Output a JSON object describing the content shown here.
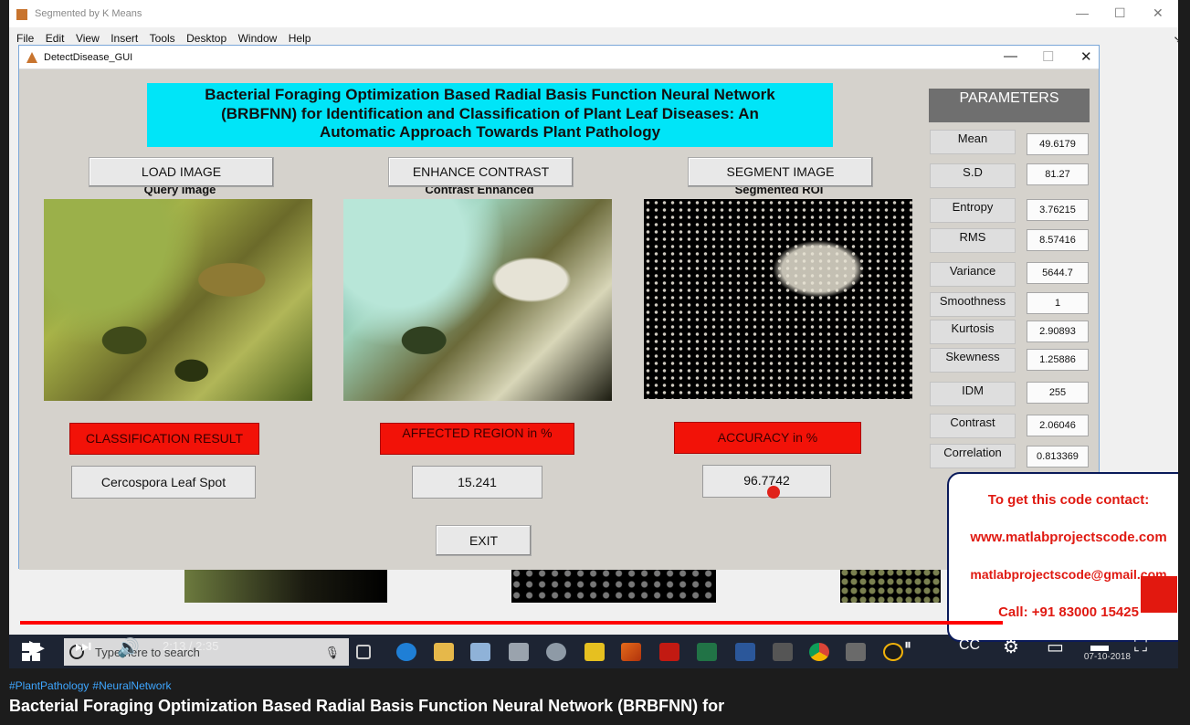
{
  "bg_window": {
    "title": "Segmented by K Means",
    "menu": [
      "File",
      "Edit",
      "View",
      "Insert",
      "Tools",
      "Desktop",
      "Window",
      "Help"
    ]
  },
  "gui_window": {
    "title": "DetectDisease_GUI",
    "banner_lines": [
      "Bacterial Foraging Optimization Based Radial Basis Function Neural Network",
      "(BRBFNN) for Identification and Classification of Plant Leaf Diseases: An",
      "Automatic Approach Towards Plant Pathology"
    ],
    "buttons": {
      "load": "LOAD IMAGE",
      "enhance": "ENHANCE CONTRAST",
      "segment": "SEGMENT IMAGE",
      "exit": "EXIT"
    },
    "image_captions": [
      "Query Image",
      "Contrast Enhanced",
      "Segmented ROI"
    ],
    "results": {
      "classification_label": "CLASSIFICATION RESULT",
      "classification_value": "Cercospora Leaf Spot",
      "affected_label": "AFFECTED REGION in %",
      "affected_value": "15.241",
      "accuracy_label": "ACCURACY in %",
      "accuracy_value": "96.7742"
    },
    "parameters": {
      "heading": "PARAMETERS",
      "items": [
        {
          "name": "Mean",
          "value": "49.6179"
        },
        {
          "name": "S.D",
          "value": "81.27"
        },
        {
          "name": "Entropy",
          "value": "3.76215"
        },
        {
          "name": "RMS",
          "value": "8.57416"
        },
        {
          "name": "Variance",
          "value": "5644.7"
        },
        {
          "name": "Smoothness",
          "value": "1"
        },
        {
          "name": "Kurtosis",
          "value": "2.90893"
        },
        {
          "name": "Skewness",
          "value": "1.25886"
        },
        {
          "name": "IDM",
          "value": "255"
        },
        {
          "name": "Contrast",
          "value": "2.06046"
        },
        {
          "name": "Correlation",
          "value": "0.813369"
        }
      ]
    }
  },
  "contact": {
    "line1": "To get this code contact:",
    "line2": "www.matlabprojectscode.com",
    "line3": "matlabprojectscode@gmail.com",
    "line4": "Call: +91 83000 15425"
  },
  "taskbar": {
    "search_placeholder": "Type here to search",
    "date": "07-10-2018"
  },
  "player": {
    "time": "2:13 / 2:35",
    "progress_fraction": 0.857
  },
  "hashtags": [
    "#PlantPathology",
    "#NeuralNetwork"
  ],
  "video_title": "Bacterial Foraging Optimization Based Radial Basis Function Neural Network (BRBFNN) for",
  "colors": {
    "banner": "#00e5f8",
    "result_label": "#f21208",
    "progress": "#ff0000",
    "contact_text": "#e01a12"
  }
}
